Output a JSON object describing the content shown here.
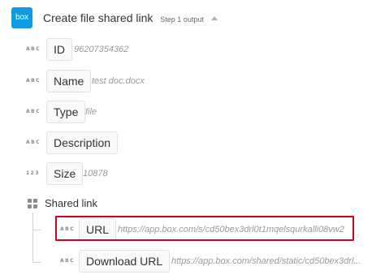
{
  "header": {
    "logo_text": "box",
    "logo_color": "#0f9be3",
    "title": "Create file shared link",
    "subtitle": "Step 1 output"
  },
  "fields": [
    {
      "type": "ABC",
      "key": "ID",
      "value": "96207354362"
    },
    {
      "type": "ABC",
      "key": "Name",
      "value": "test doc.docx"
    },
    {
      "type": "ABC",
      "key": "Type",
      "value": "file"
    },
    {
      "type": "ABC",
      "key": "Description",
      "value": ""
    },
    {
      "type": "123",
      "key": "Size",
      "value": "10878"
    }
  ],
  "shared_link": {
    "label": "Shared link",
    "items": [
      {
        "type": "ABC",
        "key": "URL",
        "value": "https://app.box.com/s/cd50bex3drl0t1mqelsqurkalli08vw2"
      },
      {
        "type": "ABC",
        "key": "Download URL",
        "value": "https://app.box.com/shared/static/cd50bex3drl..."
      }
    ]
  },
  "highlight_color": "#d0021b"
}
